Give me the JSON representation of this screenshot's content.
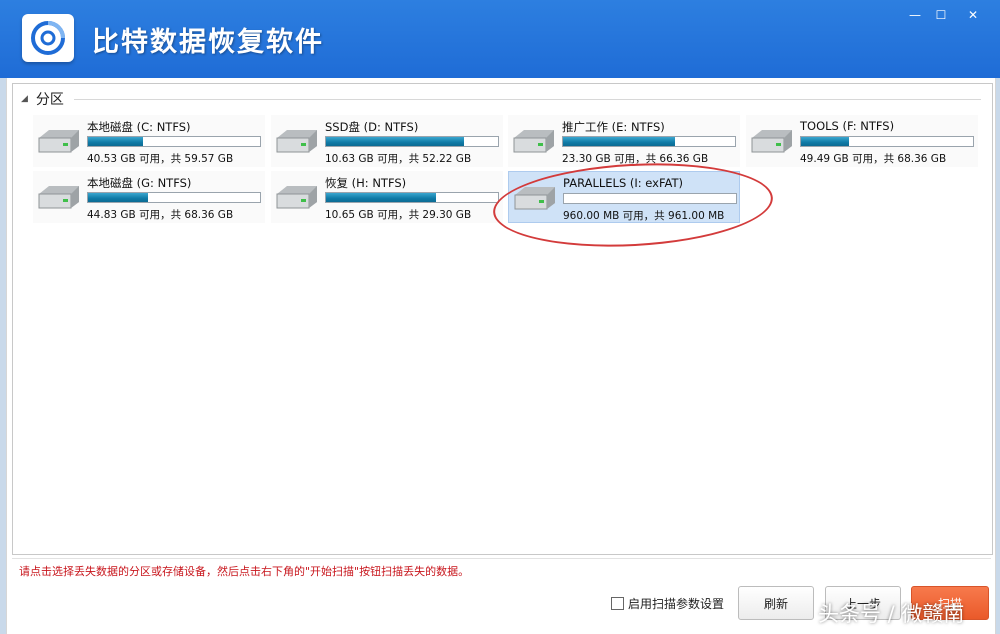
{
  "app": {
    "title": "比特数据恢复软件"
  },
  "window_controls": {
    "minimize": "—",
    "maximize": "☐",
    "close": "✕"
  },
  "group": {
    "label": "分区"
  },
  "partitions": [
    {
      "name": "本地磁盘 (C: NTFS)",
      "stat": "40.53 GB 可用，共 59.57 GB",
      "used_fraction": 0.32
    },
    {
      "name": "SSD盘 (D: NTFS)",
      "stat": "10.63 GB 可用，共 52.22 GB",
      "used_fraction": 0.8
    },
    {
      "name": "推广工作 (E: NTFS)",
      "stat": "23.30 GB 可用，共 66.36 GB",
      "used_fraction": 0.65
    },
    {
      "name": "TOOLS (F: NTFS)",
      "stat": "49.49 GB 可用，共 68.36 GB",
      "used_fraction": 0.28
    },
    {
      "name": "本地磁盘 (G: NTFS)",
      "stat": "44.83 GB 可用，共 68.36 GB",
      "used_fraction": 0.35
    },
    {
      "name": "恢复 (H: NTFS)",
      "stat": "10.65 GB 可用，共 29.30 GB",
      "used_fraction": 0.64
    },
    {
      "name": "PARALLELS (I: exFAT)",
      "stat": "960.00 MB 可用，共 961.00 MB",
      "used_fraction": 0.001,
      "selected": true
    }
  ],
  "hint": "请点击选择丢失数据的分区或存储设备，然后点击右下角的\"开始扫描\"按钮扫描丢失的数据。",
  "footer": {
    "checkbox_label": "启用扫描参数设置",
    "refresh": "刷新",
    "prev": "上一步",
    "scan": "扫描"
  },
  "watermark": "头条号 / 微赣南",
  "colors": {
    "titlebar": "#2276dc",
    "accent": "#ea5a2a",
    "hint": "#c8161d",
    "bar_fill": "#0f7aa6",
    "annotation": "#d33b3b"
  }
}
